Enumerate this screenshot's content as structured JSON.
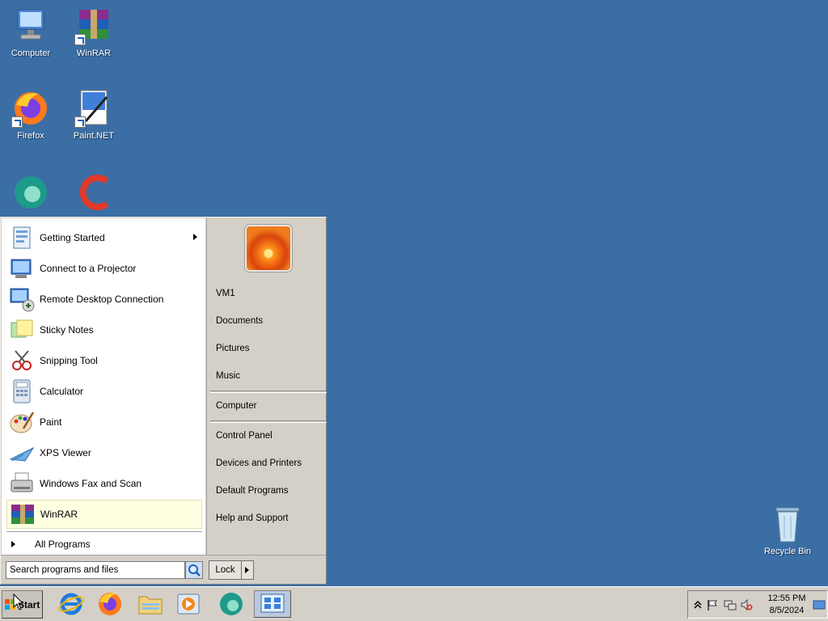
{
  "desktop": {
    "icons": [
      {
        "label": "Computer",
        "icon": "computer-icon"
      },
      {
        "label": "WinRAR",
        "icon": "winrar-icon"
      },
      {
        "label": "Firefox",
        "icon": "firefox-icon"
      },
      {
        "label": "Paint.NET",
        "icon": "paintnet-icon"
      },
      {
        "label": "Recycle Bin",
        "icon": "recycle-bin-icon"
      }
    ]
  },
  "start_menu": {
    "programs": [
      {
        "label": "Getting Started",
        "icon": "getting-started-icon",
        "has_submenu": true
      },
      {
        "label": "Connect to a Projector",
        "icon": "projector-icon"
      },
      {
        "label": "Remote Desktop Connection",
        "icon": "remote-desktop-icon"
      },
      {
        "label": "Sticky Notes",
        "icon": "sticky-notes-icon"
      },
      {
        "label": "Snipping Tool",
        "icon": "snipping-tool-icon"
      },
      {
        "label": "Calculator",
        "icon": "calculator-icon"
      },
      {
        "label": "Paint",
        "icon": "paint-icon"
      },
      {
        "label": "XPS Viewer",
        "icon": "xps-viewer-icon"
      },
      {
        "label": "Windows Fax and Scan",
        "icon": "fax-scan-icon"
      },
      {
        "label": "WinRAR",
        "icon": "winrar-icon",
        "highlighted": true
      }
    ],
    "all_programs_label": "All Programs",
    "right_items": {
      "user": "VM1",
      "documents": "Documents",
      "pictures": "Pictures",
      "music": "Music",
      "computer": "Computer",
      "control_panel": "Control Panel",
      "devices_printers": "Devices and Printers",
      "default_programs": "Default Programs",
      "help_support": "Help and Support"
    },
    "search_value": "Search programs and files",
    "lock_label": "Lock"
  },
  "taskbar": {
    "start_label": "Start",
    "pinned": [
      "internet-explorer-icon",
      "firefox-icon",
      "file-explorer-icon",
      "media-player-icon",
      "edge-like-icon",
      "control-panel-icon"
    ],
    "clock_time": "12:55 PM",
    "clock_date": "8/5/2024"
  },
  "colors": {
    "desktop_background": "#3a6ea5",
    "menu_background": "#d4d0c8",
    "highlight": "#ffffe1"
  }
}
